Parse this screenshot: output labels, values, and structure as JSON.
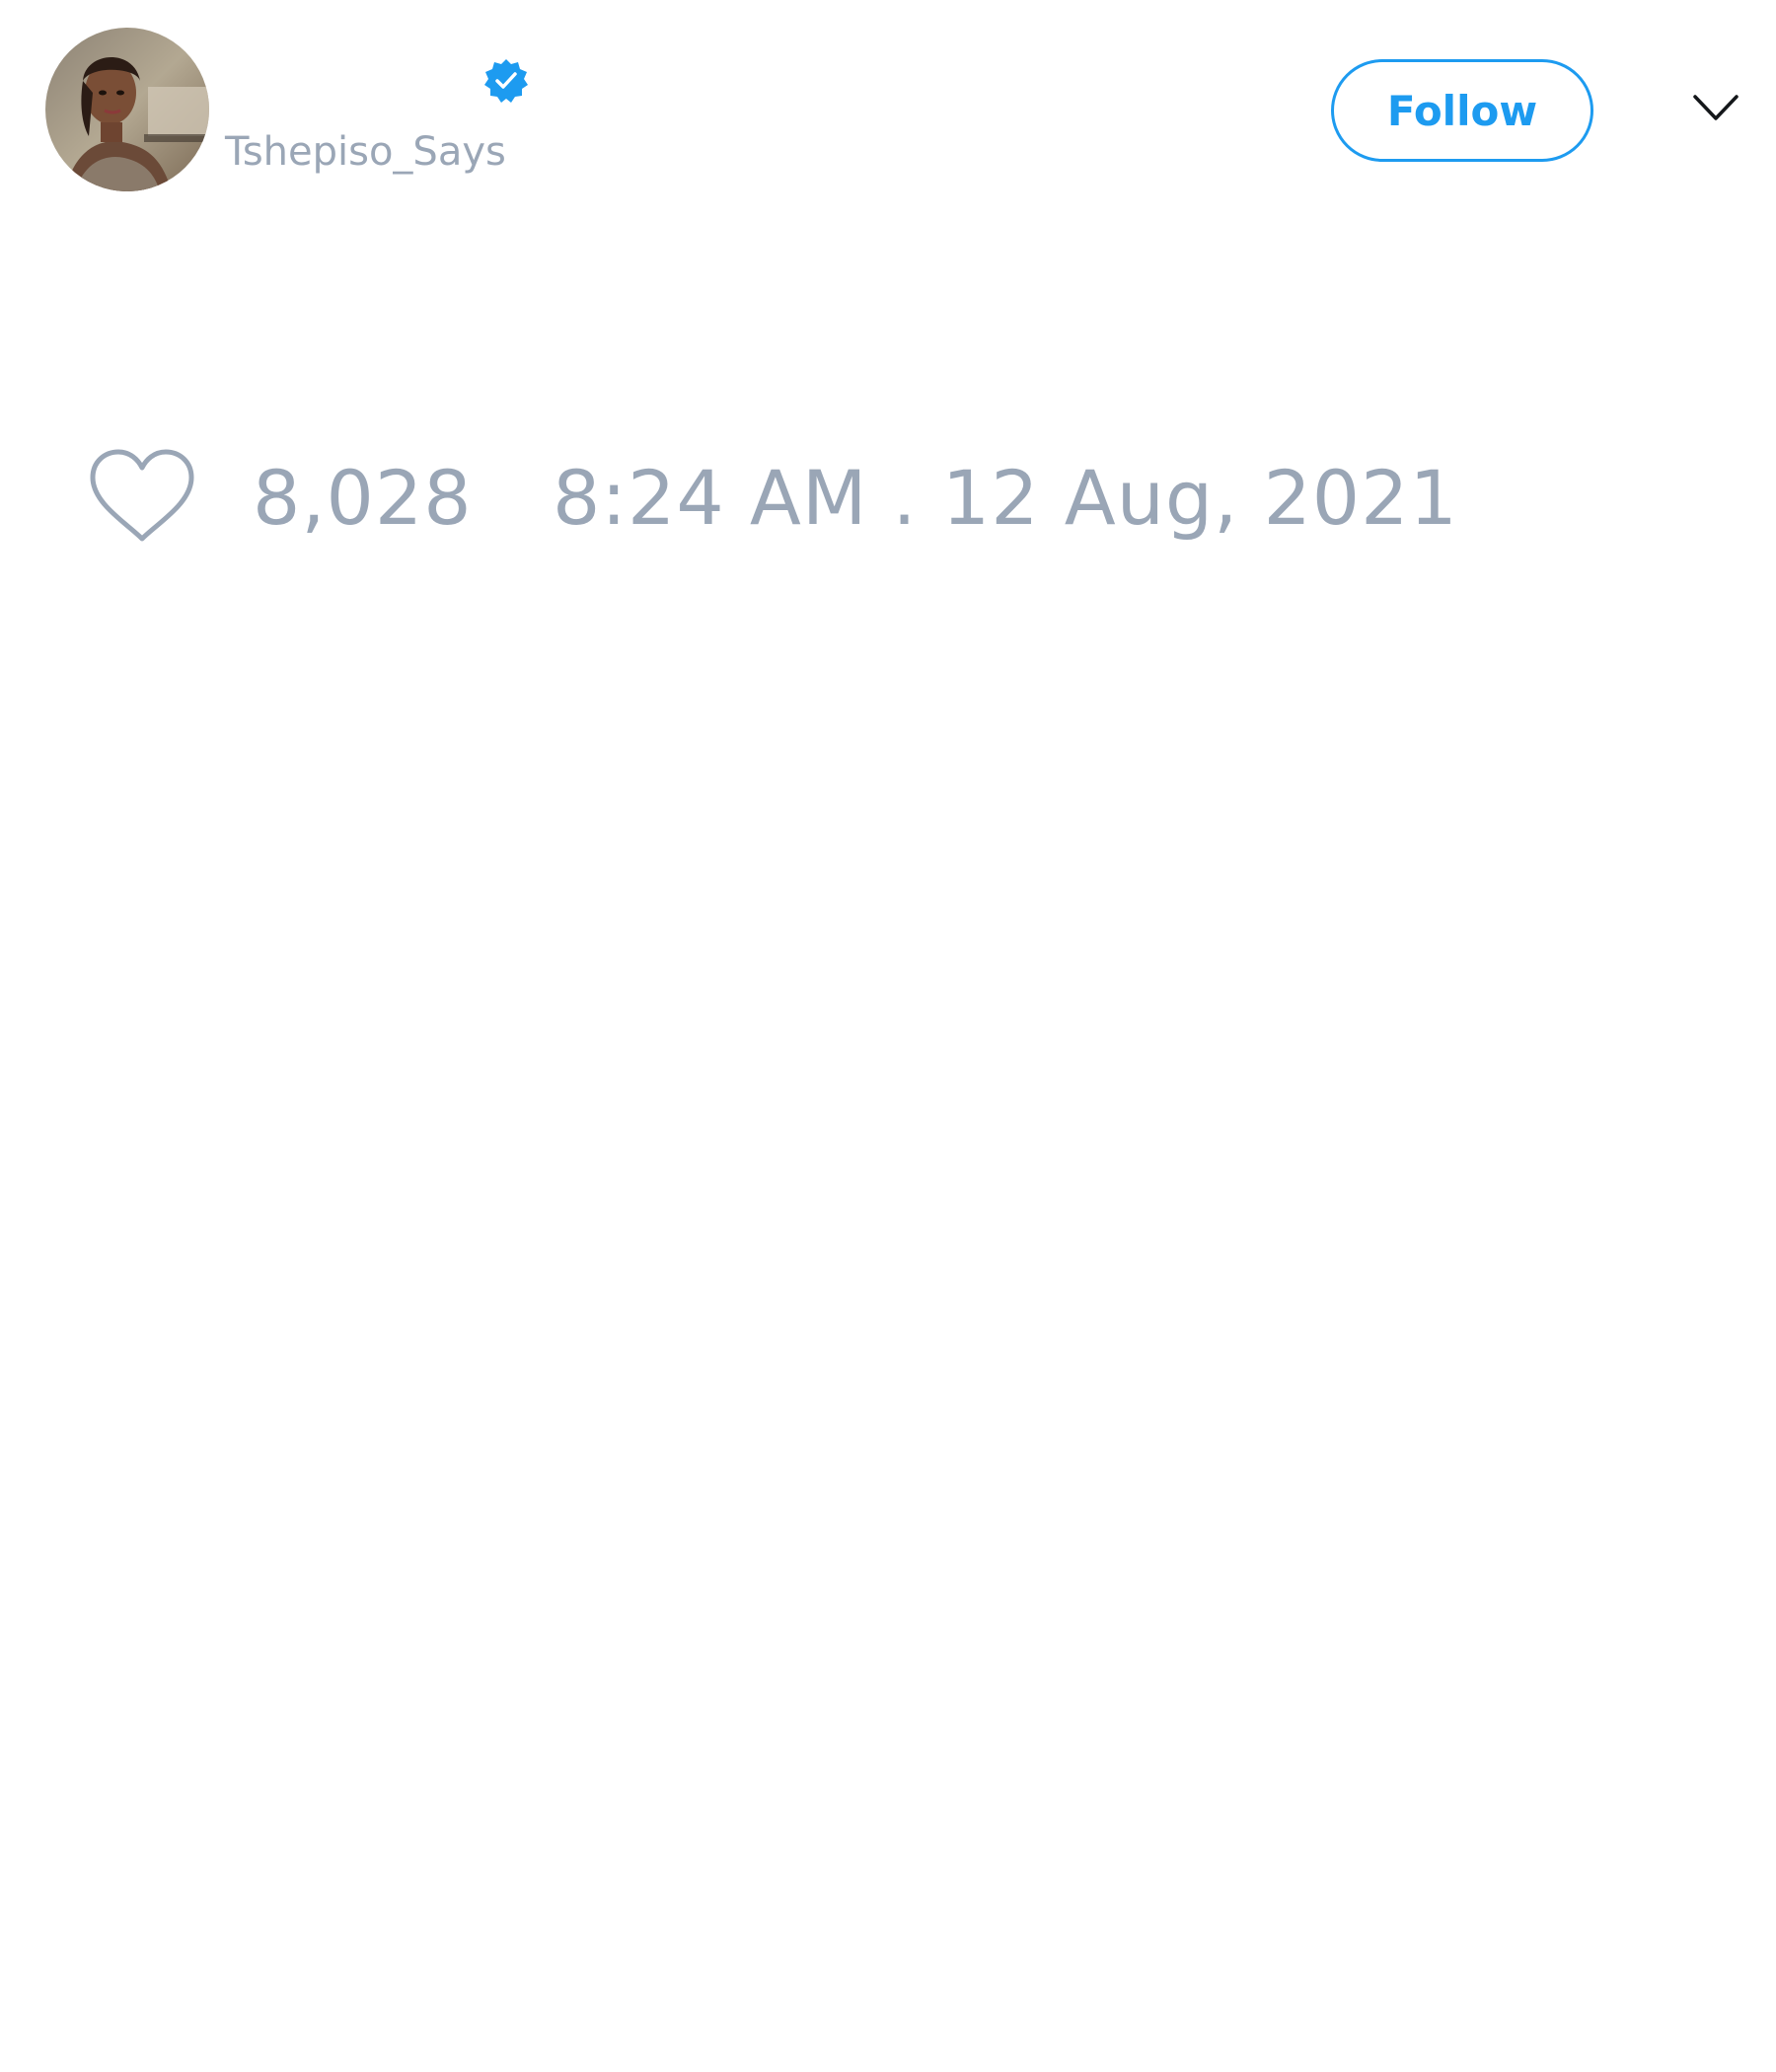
{
  "tweet": {
    "author": {
      "display_name": "",
      "handle": "Tshepiso_Says",
      "verified": true,
      "avatar": "profile-photo"
    },
    "follow_label": "Follow",
    "menu_icon": "chevron-down-icon",
    "likes": "8,028",
    "like_icon": "heart-icon",
    "timestamp": "8:24 AM . 12 Aug, 2021"
  },
  "colors": {
    "accent": "#1d9bf0",
    "muted_text": "#9aa6b6",
    "background": "#ffffff"
  }
}
